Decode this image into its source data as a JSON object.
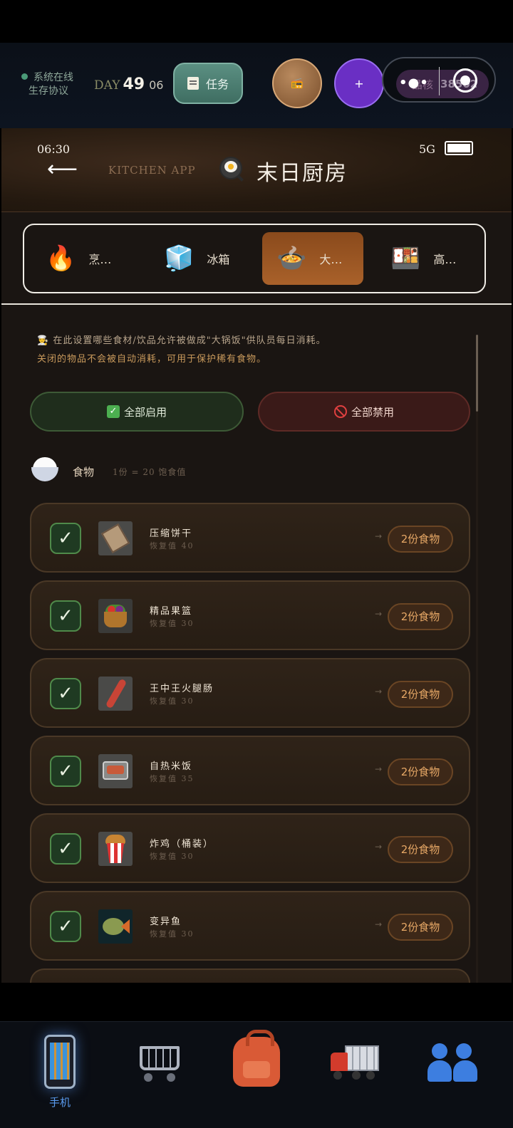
{
  "status_bar": {
    "system_status": "系统在线",
    "protocol": "生存协议",
    "day_label": "DAY",
    "day_number": "49",
    "day_sub": "06",
    "task_label": "任务",
    "plus_label": "+",
    "badge_text": "晶核",
    "badge_value": "38502",
    "accent_online": "#4a9a78"
  },
  "phone": {
    "time": "06:30",
    "network": "5G",
    "app_caption": "KITCHEN APP",
    "title": "末日厨房",
    "tabs": [
      {
        "icon": "fire-icon",
        "emoji": "🔥",
        "label": "烹…"
      },
      {
        "icon": "ice-cube-icon",
        "emoji": "🧊",
        "label": "冰箱"
      },
      {
        "icon": "pot-icon",
        "emoji": "🍲",
        "label": "大…",
        "active": true
      },
      {
        "icon": "bento-icon",
        "emoji": "🍱",
        "label": "高…"
      }
    ],
    "description_line1": "👨‍🍳 在此设置哪些食材/饮品允许被做成\"大锅饭\"供队员每日消耗。",
    "description_line2": "关闭的物品不会被自动消耗，可用于保护稀有食物。",
    "enable_all_label": "全部启用",
    "disable_all_label": "全部禁用",
    "section": {
      "title": "食物",
      "note": "1份 = 20 饱食值"
    },
    "items": [
      {
        "name": "压缩饼干",
        "restore": "恢复值 40",
        "output": "2份食物",
        "checked": true,
        "thumb": "biscuit-icon"
      },
      {
        "name": "精品果篮",
        "restore": "恢复值 30",
        "output": "2份食物",
        "checked": true,
        "thumb": "fruit-basket-icon"
      },
      {
        "name": "王中王火腿肠",
        "restore": "恢复值 30",
        "output": "2份食物",
        "checked": true,
        "thumb": "sausage-icon"
      },
      {
        "name": "自热米饭",
        "restore": "恢复值 35",
        "output": "2份食物",
        "checked": true,
        "thumb": "self-heating-rice-icon"
      },
      {
        "name": "炸鸡（桶装）",
        "restore": "恢复值 30",
        "output": "2份食物",
        "checked": true,
        "thumb": "fried-chicken-icon"
      },
      {
        "name": "变异鱼",
        "restore": "恢复值 30",
        "output": "2份食物",
        "checked": true,
        "thumb": "mutant-fish-icon"
      }
    ],
    "check_glyph": "✓",
    "arrow_glyph": "→"
  },
  "dock": {
    "items": [
      {
        "icon": "phone-icon",
        "label": "手机",
        "active": true
      },
      {
        "icon": "cart-icon",
        "label": ""
      },
      {
        "icon": "backpack-icon",
        "label": ""
      },
      {
        "icon": "truck-icon",
        "label": ""
      },
      {
        "icon": "people-icon",
        "label": ""
      }
    ],
    "active_color": "#5b9cf0"
  }
}
